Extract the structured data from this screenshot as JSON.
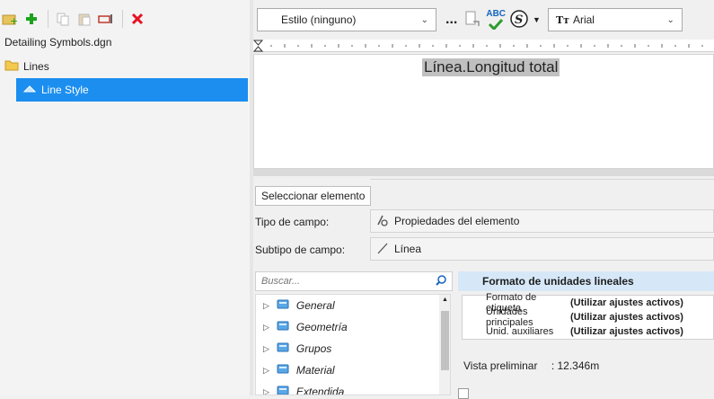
{
  "toolbar": {
    "icons": [
      "add-folder-icon",
      "add-icon",
      "copy-icon",
      "paste-icon",
      "rename-icon",
      "delete-icon"
    ]
  },
  "tree": {
    "file": "Detailing Symbols.dgn",
    "folder": "Lines",
    "selected_item": "Line Style"
  },
  "format_bar": {
    "style_combo": "Estilo (ninguno)",
    "more": "...",
    "spell": "ABC",
    "font_combo": "Arial"
  },
  "editor": {
    "text": "Línea.Longitud total"
  },
  "field": {
    "select_button": "Seleccionar elemento",
    "tipo_label": "Tipo de campo:",
    "tipo_value": "Propiedades del elemento",
    "subtipo_label": "Subtipo de campo:",
    "subtipo_value": "Línea"
  },
  "search": {
    "placeholder": "Buscar..."
  },
  "categories": [
    "General",
    "Geometría",
    "Grupos",
    "Material",
    "Extendida"
  ],
  "properties": {
    "header": "Formato de unidades lineales",
    "rows": [
      {
        "key": "Formato de etiqueta",
        "value": "(Utilizar ajustes activos)"
      },
      {
        "key": "Unidades principales",
        "value": "(Utilizar ajustes activos)"
      },
      {
        "key": "Unid. auxiliares",
        "value": "(Utilizar ajustes activos)"
      }
    ],
    "preview_label": "Vista preliminar",
    "preview_value": ": 12.346m"
  },
  "colors": {
    "selection": "#1b8ef0",
    "header": "#d6e8f8",
    "delete": "#e81123",
    "add": "#1aa31a"
  }
}
